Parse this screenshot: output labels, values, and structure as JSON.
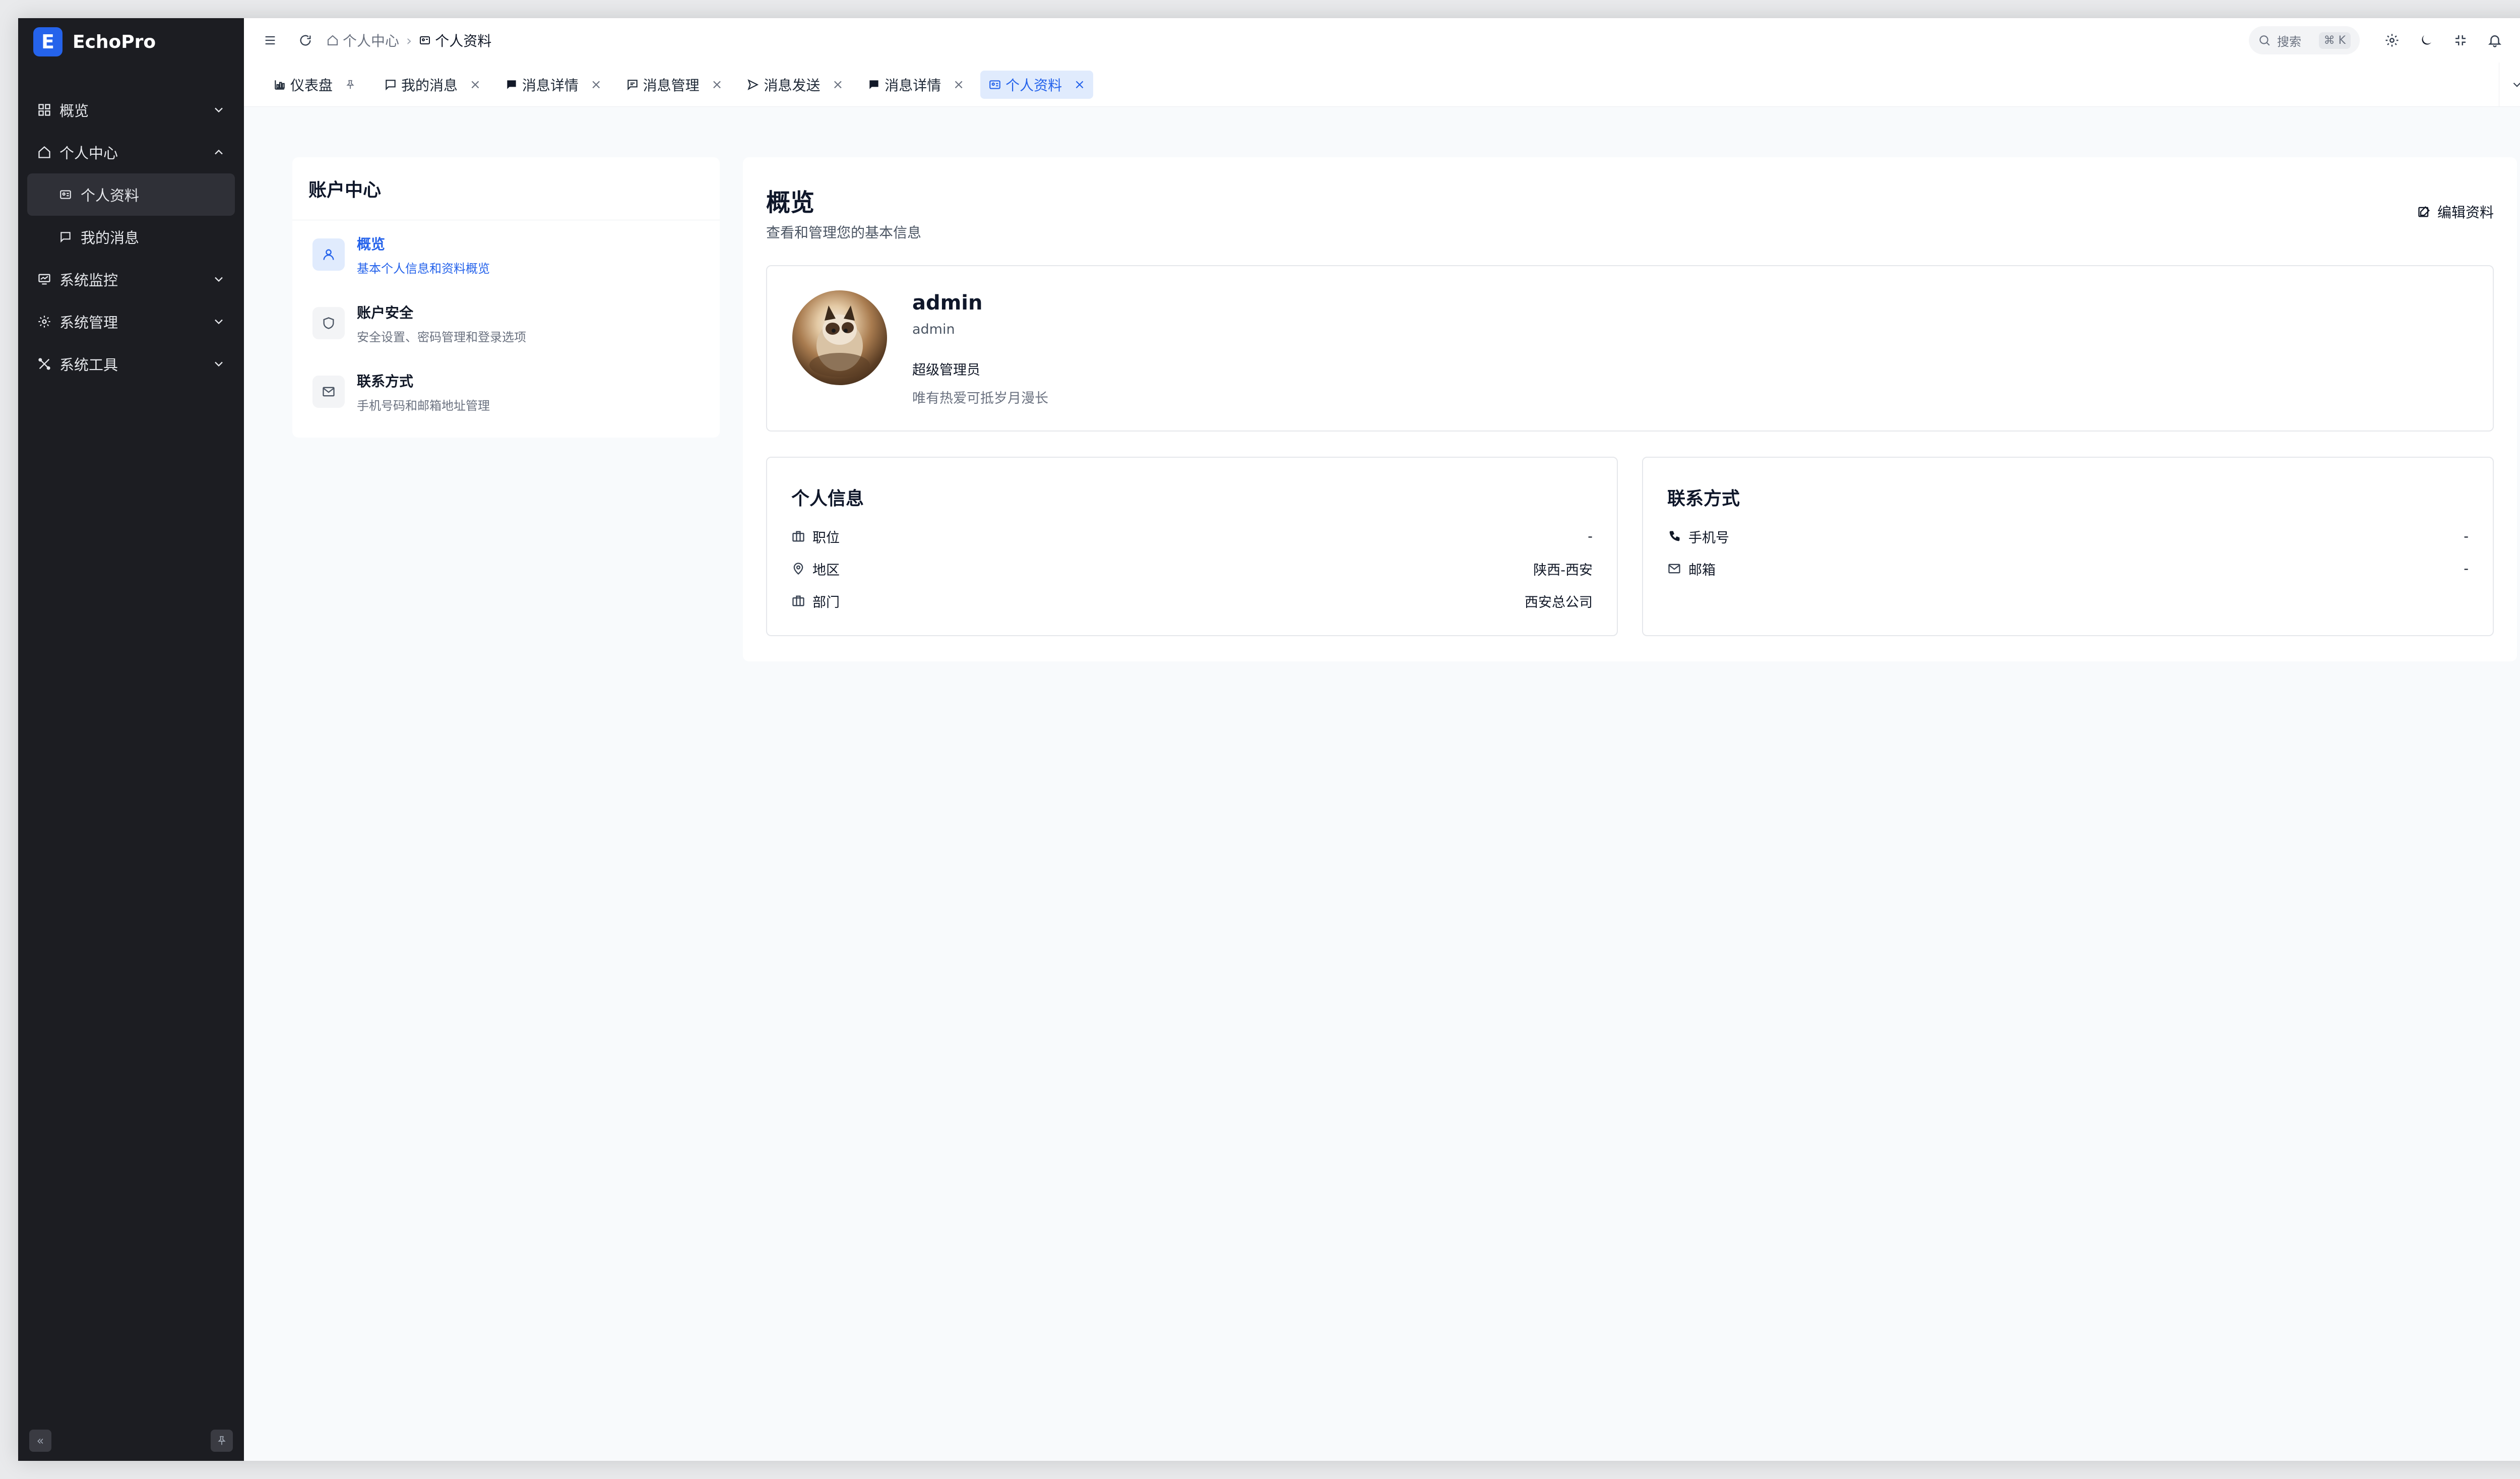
{
  "app": {
    "name": "EchoPro",
    "logo_letter": "E"
  },
  "sidebar": {
    "items": [
      {
        "label": "概览",
        "icon": "dashboard-grid-icon"
      },
      {
        "label": "个人中心",
        "icon": "home-icon",
        "expanded": true,
        "children": [
          {
            "label": "个人资料",
            "icon": "profile-card-icon",
            "active": true
          },
          {
            "label": "我的消息",
            "icon": "message-bubble-icon"
          }
        ]
      },
      {
        "label": "系统监控",
        "icon": "monitor-icon"
      },
      {
        "label": "系统管理",
        "icon": "gear-icon"
      },
      {
        "label": "系统工具",
        "icon": "tools-icon"
      }
    ]
  },
  "header": {
    "breadcrumb": [
      "个人中心",
      "个人资料"
    ],
    "search_placeholder": "搜索",
    "search_shortcut": "⌘ K"
  },
  "tabs": [
    {
      "label": "仪表盘",
      "icon": "chart-icon",
      "pinned": true
    },
    {
      "label": "我的消息",
      "icon": "message-bubble-icon"
    },
    {
      "label": "消息详情",
      "icon": "message-filled-icon"
    },
    {
      "label": "消息管理",
      "icon": "message-manage-icon"
    },
    {
      "label": "消息发送",
      "icon": "send-icon"
    },
    {
      "label": "消息详情",
      "icon": "message-filled-icon"
    },
    {
      "label": "个人资料",
      "icon": "profile-card-icon",
      "active": true
    }
  ],
  "account_center": {
    "title": "账户中心",
    "items": [
      {
        "title": "概览",
        "desc": "基本个人信息和资料概览",
        "icon": "user-icon",
        "active": true
      },
      {
        "title": "账户安全",
        "desc": "安全设置、密码管理和登录选项",
        "icon": "shield-icon"
      },
      {
        "title": "联系方式",
        "desc": "手机号码和邮箱地址管理",
        "icon": "mail-icon"
      }
    ]
  },
  "overview": {
    "title": "概览",
    "subtitle": "查看和管理您的基本信息",
    "edit_label": "编辑资料",
    "profile": {
      "name": "admin",
      "username": "admin",
      "role": "超级管理员",
      "motto": "唯有热爱可抵岁月漫长"
    },
    "personal_info": {
      "title": "个人信息",
      "rows": [
        {
          "label": "职位",
          "value": "-",
          "icon": "briefcase-icon"
        },
        {
          "label": "地区",
          "value": "陕西-西安",
          "icon": "location-pin-icon"
        },
        {
          "label": "部门",
          "value": "西安总公司",
          "icon": "building-icon"
        }
      ]
    },
    "contact": {
      "title": "联系方式",
      "rows": [
        {
          "label": "手机号",
          "value": "-",
          "icon": "phone-icon"
        },
        {
          "label": "邮箱",
          "value": "-",
          "icon": "mail-icon"
        }
      ]
    }
  },
  "colors": {
    "sidebar_bg": "#1c1d22",
    "accent": "#2563eb",
    "active_tab_bg": "#e0ebfd"
  }
}
